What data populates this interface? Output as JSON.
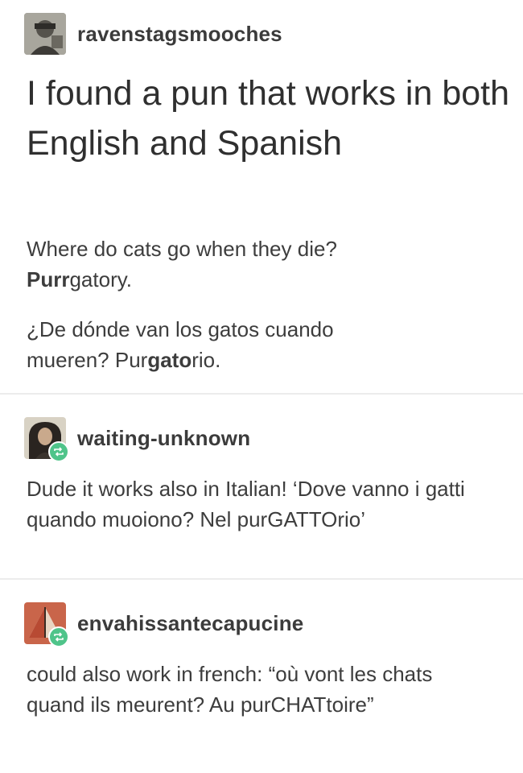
{
  "original_post": {
    "username": "ravenstagsmooches",
    "title": "I found a pun that works in both English and Spanish",
    "english": {
      "question": "Where do cats go when they die?",
      "answer_bold": "Purr",
      "answer_rest": "gatory."
    },
    "spanish": {
      "question": "¿De dónde van los gatos cuando mueren?",
      "answer_pre": "Pur",
      "answer_bold": "gato",
      "answer_post": "rio."
    }
  },
  "reblogs": [
    {
      "username": "waiting-unknown",
      "text": "Dude it works also in Italian! ‘Dove vanno i gatti quando muoiono? Nel purGATTOrio’"
    },
    {
      "username": "envahissantecapucine",
      "text": "could also work in french: “où vont les chats quand ils meurent? Au purCHATtoire”"
    }
  ],
  "icons": {
    "reblog": "reblog-icon",
    "avatar": "avatar"
  },
  "colors": {
    "reblog_badge": "#4fc48a",
    "text": "#3d3d3d"
  }
}
